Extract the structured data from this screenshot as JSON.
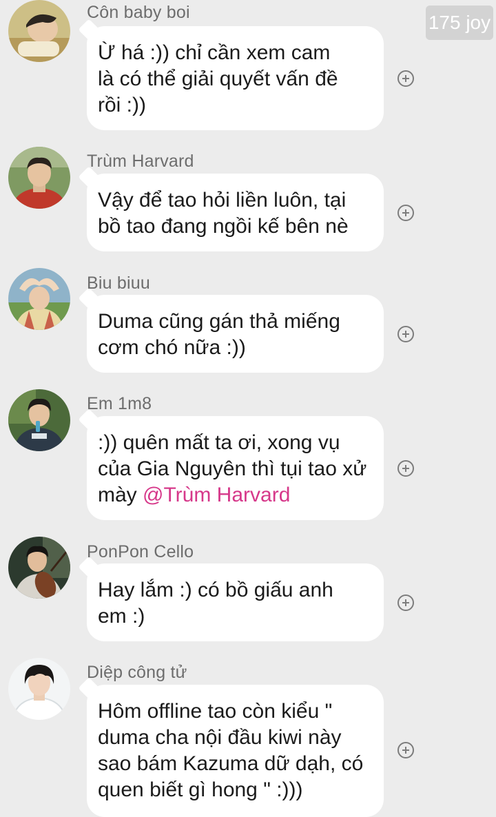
{
  "badge": {
    "text": "175 joy"
  },
  "messages": [
    {
      "sender": "Côn baby boi",
      "lines": [
        "Ừ há :)) chỉ cần xem cam",
        "là có thể giải quyết vấn đề",
        "rồi :))"
      ]
    },
    {
      "sender": "Trùm Harvard",
      "lines": [
        "Vậy để tao hỏi liền luôn, tại",
        "bồ tao đang ngồi kế bên nè"
      ]
    },
    {
      "sender": "Biu biuu",
      "lines": [
        "Duma cũng gán thả miếng",
        "cơm chó nữa :))"
      ]
    },
    {
      "sender": "Em 1m8",
      "lines": [
        ":)) quên mất ta ơi, xong vụ",
        "của Gia Nguyên thì tụi tao xử"
      ],
      "last_line_prefix": "mày ",
      "mention": "@Trùm Harvard"
    },
    {
      "sender": "PonPon Cello",
      "lines": [
        "Hay lắm :) có bồ giấu anh",
        "em :)"
      ]
    },
    {
      "sender": "Diệp công tử",
      "lines": [
        "Hôm offline tao còn kiểu \"",
        "duma cha nội đầu kiwi này",
        "sao bám Kazuma dữ dạh, có",
        "quen biết gì hong \" :)))"
      ]
    }
  ]
}
